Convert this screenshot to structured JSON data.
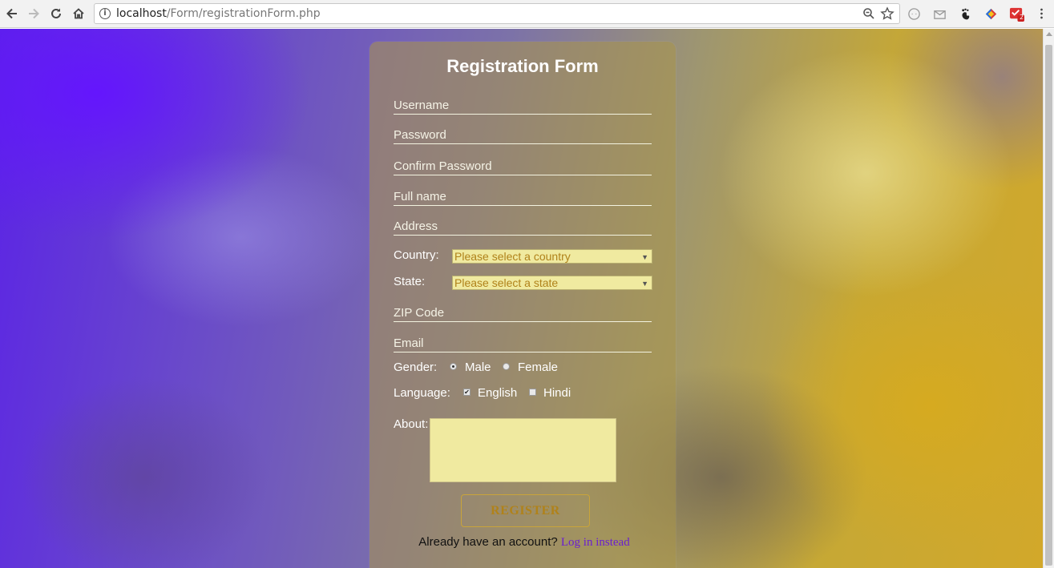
{
  "browser": {
    "url_host": "localhost",
    "url_path": "/Form/registrationForm.php",
    "extension_badge": "2"
  },
  "form": {
    "title": "Registration Form",
    "fields": {
      "username": "Username",
      "password": "Password",
      "confirm_password": "Confirm Password",
      "full_name": "Full name",
      "address": "Address",
      "zip": "ZIP Code",
      "email": "Email"
    },
    "country_label": "Country:",
    "country_value": "Please select a country",
    "state_label": "State:",
    "state_value": "Please select a state",
    "gender_label": "Gender:",
    "gender_options": [
      "Male",
      "Female"
    ],
    "gender_selected": "Male",
    "language_label": "Language:",
    "language_options": [
      "English",
      "Hindi"
    ],
    "language_checked": [
      "English"
    ],
    "about_label": "About:",
    "register_label": "REGISTER",
    "account_text": "Already have an account?",
    "login_link": "Log in instead"
  },
  "colors": {
    "accent_link": "#6a1fd0",
    "register_text": "#b0821a",
    "input_fill": "#f0eaa0"
  }
}
